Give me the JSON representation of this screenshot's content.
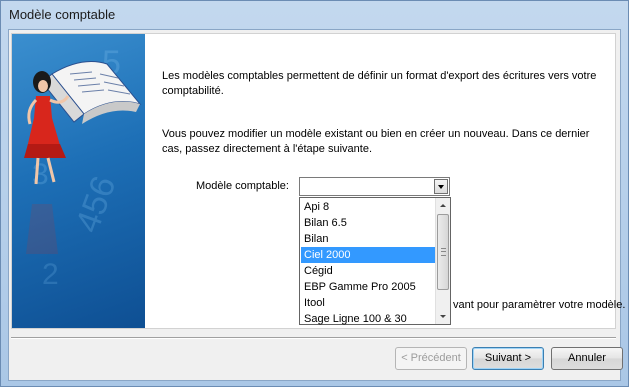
{
  "window": {
    "title": "Modèle comptable"
  },
  "content": {
    "paragraph1": "Les modèles comptables permettent de définir un format d'export des écritures vers votre comptabilité.",
    "paragraph2": "Vous pouvez modifier un modèle existant ou bien en créer un nouveau. Dans ce dernier cas, passez directement à l'étape suivante.",
    "model_label": "Modèle comptable:",
    "combo_value": "",
    "hidden_text_fragment": "vant pour paramètrer votre modèle."
  },
  "dropdown": {
    "items": [
      "Api 8",
      "Bilan 6.5",
      "Bilan",
      "Ciel 2000",
      "Cégid",
      "EBP Gamme Pro 2005",
      "Itool",
      "Sage Ligne 100 & 30"
    ],
    "selected": "Ciel 2000"
  },
  "buttons": {
    "previous": "< Précédent",
    "next": "Suivant >",
    "cancel": "Annuler"
  },
  "colors": {
    "selection": "#3399ff",
    "side_panel": "#1d6fb6"
  }
}
